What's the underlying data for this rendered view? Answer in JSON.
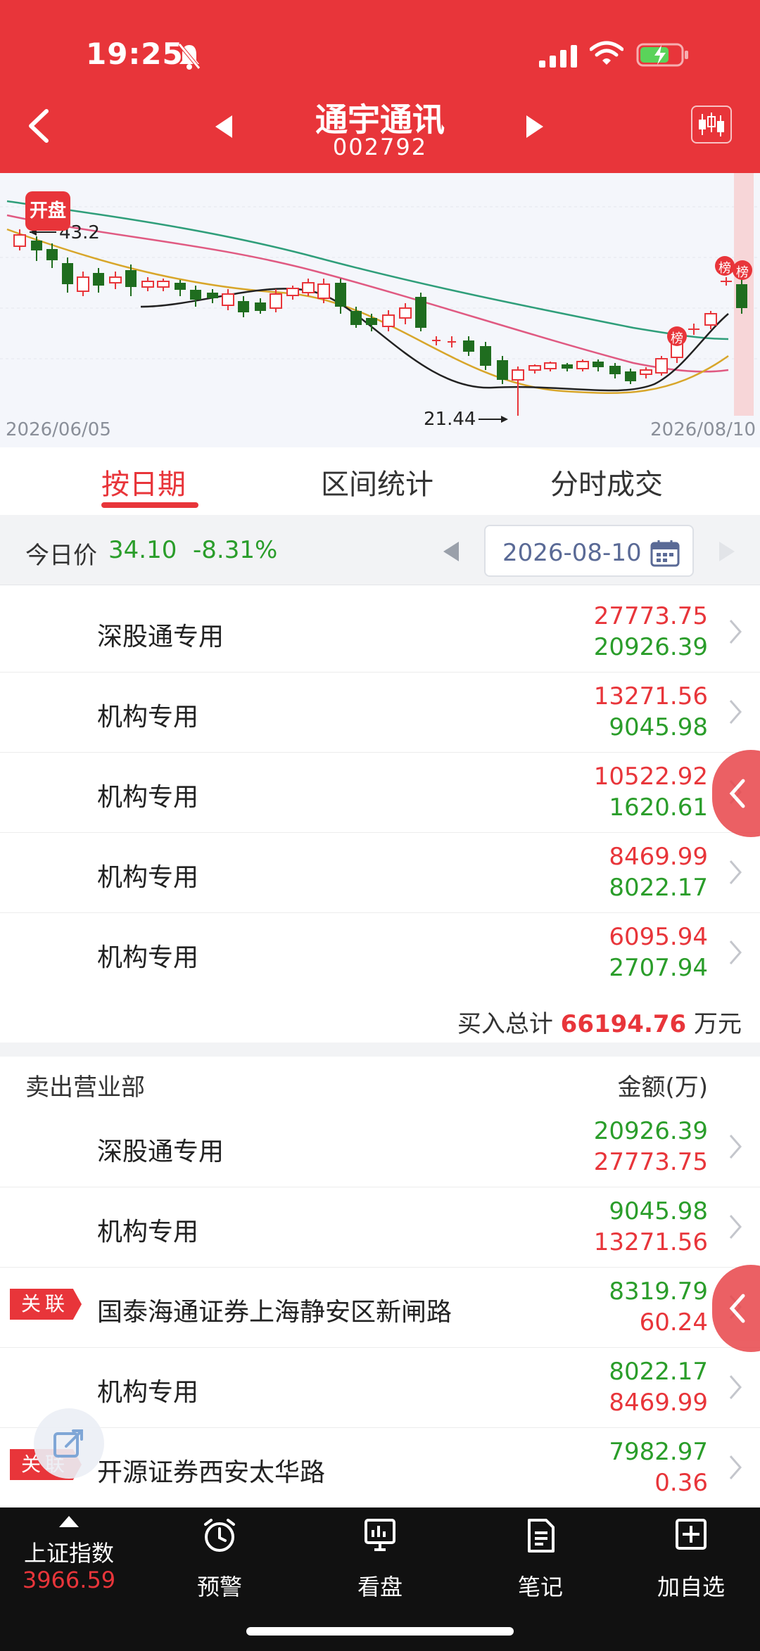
{
  "status_bar": {
    "time": "19:25"
  },
  "header": {
    "stock_name": "通宇通讯",
    "stock_code": "002792"
  },
  "chart": {
    "start_date": "2026/06/05",
    "end_date": "2026/08/10",
    "high_label": "43.2",
    "low_label": "21.44",
    "badge": "开盘",
    "rank_marker": "榜"
  },
  "tabs": [
    {
      "label": "按日期"
    },
    {
      "label": "区间统计"
    },
    {
      "label": "分时成交"
    }
  ],
  "price_bar": {
    "label": "今日价",
    "price": "34.10",
    "change_pct": "-8.31%",
    "date": "2026-08-10"
  },
  "buy_rows": [
    {
      "name": "深股通专用",
      "top": "27773.75",
      "bottom": "20926.39"
    },
    {
      "name": "机构专用",
      "top": "13271.56",
      "bottom": "9045.98"
    },
    {
      "name": "机构专用",
      "top": "10522.92",
      "bottom": "1620.61"
    },
    {
      "name": "机构专用",
      "top": "8469.99",
      "bottom": "8022.17"
    },
    {
      "name": "机构专用",
      "top": "6095.94",
      "bottom": "2707.94"
    }
  ],
  "buy_total": {
    "label": "买入总计",
    "value": "66194.76",
    "unit": "万元"
  },
  "sell_header": {
    "title": "卖出营业部",
    "amount_label": "金额(万)"
  },
  "sell_rows": [
    {
      "name": "深股通专用",
      "top": "20926.39",
      "bottom": "27773.75",
      "tag": ""
    },
    {
      "name": "机构专用",
      "top": "9045.98",
      "bottom": "13271.56",
      "tag": ""
    },
    {
      "name": "国泰海通证券上海静安区新闸路",
      "top": "8319.79",
      "bottom": "60.24",
      "tag": "关联"
    },
    {
      "name": "机构专用",
      "top": "8022.17",
      "bottom": "8469.99",
      "tag": ""
    },
    {
      "name": "开源证券西安太华路",
      "top": "7982.97",
      "bottom": "0.36",
      "tag": "关联"
    }
  ],
  "bottom_nav": {
    "index_name": "上证指数",
    "index_value": "3966.59",
    "items": [
      {
        "label": "预警",
        "icon": "alarm-clock-icon"
      },
      {
        "label": "看盘",
        "icon": "monitor-chart-icon"
      },
      {
        "label": "笔记",
        "icon": "notes-icon"
      },
      {
        "label": "加自选",
        "icon": "plus-box-icon"
      }
    ]
  },
  "colors": {
    "brand_red": "#e8353a",
    "down_green": "#2a9d2a",
    "nav_bg": "#111111"
  }
}
